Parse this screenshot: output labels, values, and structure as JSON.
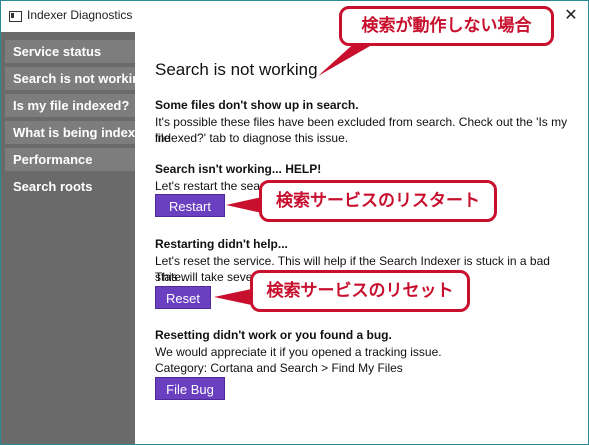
{
  "window": {
    "title": "Indexer Diagnostics",
    "close_glyph": "✕"
  },
  "sidebar": {
    "items": [
      {
        "label": "Service status"
      },
      {
        "label": "Search is not working"
      },
      {
        "label": "Is my file indexed?"
      },
      {
        "label": "What is being indexed"
      },
      {
        "label": "Performance"
      },
      {
        "label": "Search roots"
      }
    ]
  },
  "main": {
    "heading": "Search is not working",
    "section1": {
      "title": "Some files don't show up in search.",
      "line1": "It's possible these files have been excluded from search. Check out the 'Is my file",
      "line2": "indexed?' tab to diagnose this issue."
    },
    "section2": {
      "title": "Search isn't working... HELP!",
      "line1": "Let's restart the search",
      "button": "Restart"
    },
    "section3": {
      "title": "Restarting didn't help...",
      "line1": "Let's reset the service. This will help if the Search Indexer is stuck in a bad state.",
      "line2": "This will take several",
      "button": "Reset"
    },
    "section4": {
      "title": "Resetting didn't work or you found a bug.",
      "line1": "We would appreciate it if you opened a tracking issue.",
      "line2": "Category: Cortana and Search > Find My Files",
      "button": "File Bug"
    }
  },
  "annotations": {
    "callout_top": "検索が動作しない場合",
    "callout_restart": "検索サービスのリスタート",
    "callout_reset": "検索サービスのリセット",
    "color": "#c8102e"
  }
}
